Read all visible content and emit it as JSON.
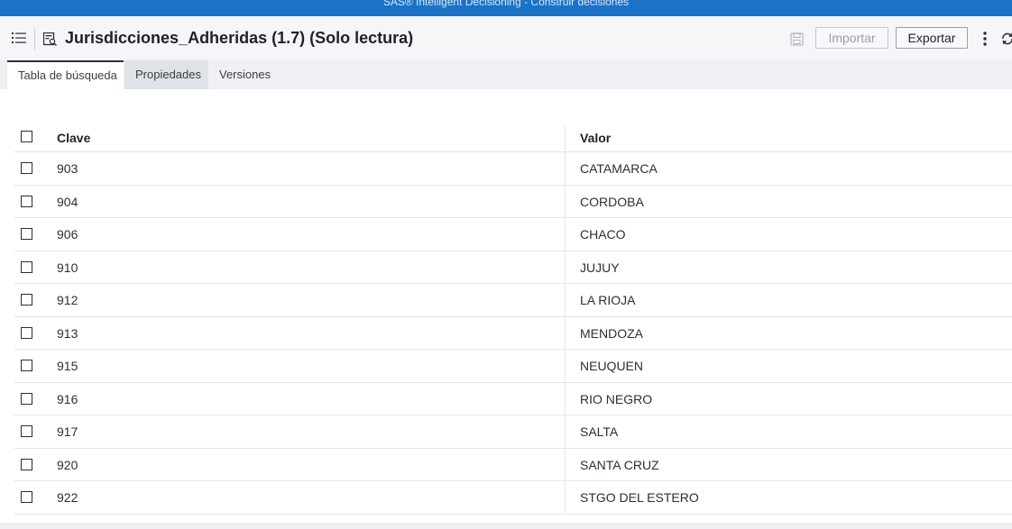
{
  "app": {
    "title": "SAS® Intelligent Decisioning - Construir decisiones"
  },
  "header": {
    "title": "Jurisdicciones_Adheridas (1.7) (Solo lectura)",
    "import_label": "Importar",
    "export_label": "Exportar",
    "icons": [
      "list-menu-icon",
      "lookup-table-icon",
      "save-icon",
      "kebab-menu-icon",
      "refresh-icon"
    ]
  },
  "tabs": [
    {
      "label": "Tabla de búsqueda",
      "active": true
    },
    {
      "label": "Propiedades",
      "active": false
    },
    {
      "label": "Versiones",
      "active": false
    }
  ],
  "table": {
    "columns": [
      "Clave",
      "Valor"
    ],
    "rows": [
      {
        "key": "903",
        "value": "CATAMARCA"
      },
      {
        "key": "904",
        "value": "CORDOBA"
      },
      {
        "key": "906",
        "value": "CHACO"
      },
      {
        "key": "910",
        "value": "JUJUY"
      },
      {
        "key": "912",
        "value": "LA RIOJA"
      },
      {
        "key": "913",
        "value": "MENDOZA"
      },
      {
        "key": "915",
        "value": "NEUQUEN"
      },
      {
        "key": "916",
        "value": "RIO NEGRO"
      },
      {
        "key": "917",
        "value": "SALTA"
      },
      {
        "key": "920",
        "value": "SANTA CRUZ"
      },
      {
        "key": "922",
        "value": "STGO DEL ESTERO"
      }
    ]
  },
  "colors": {
    "accent": "#1a73c6",
    "background": "#eef0f3"
  }
}
